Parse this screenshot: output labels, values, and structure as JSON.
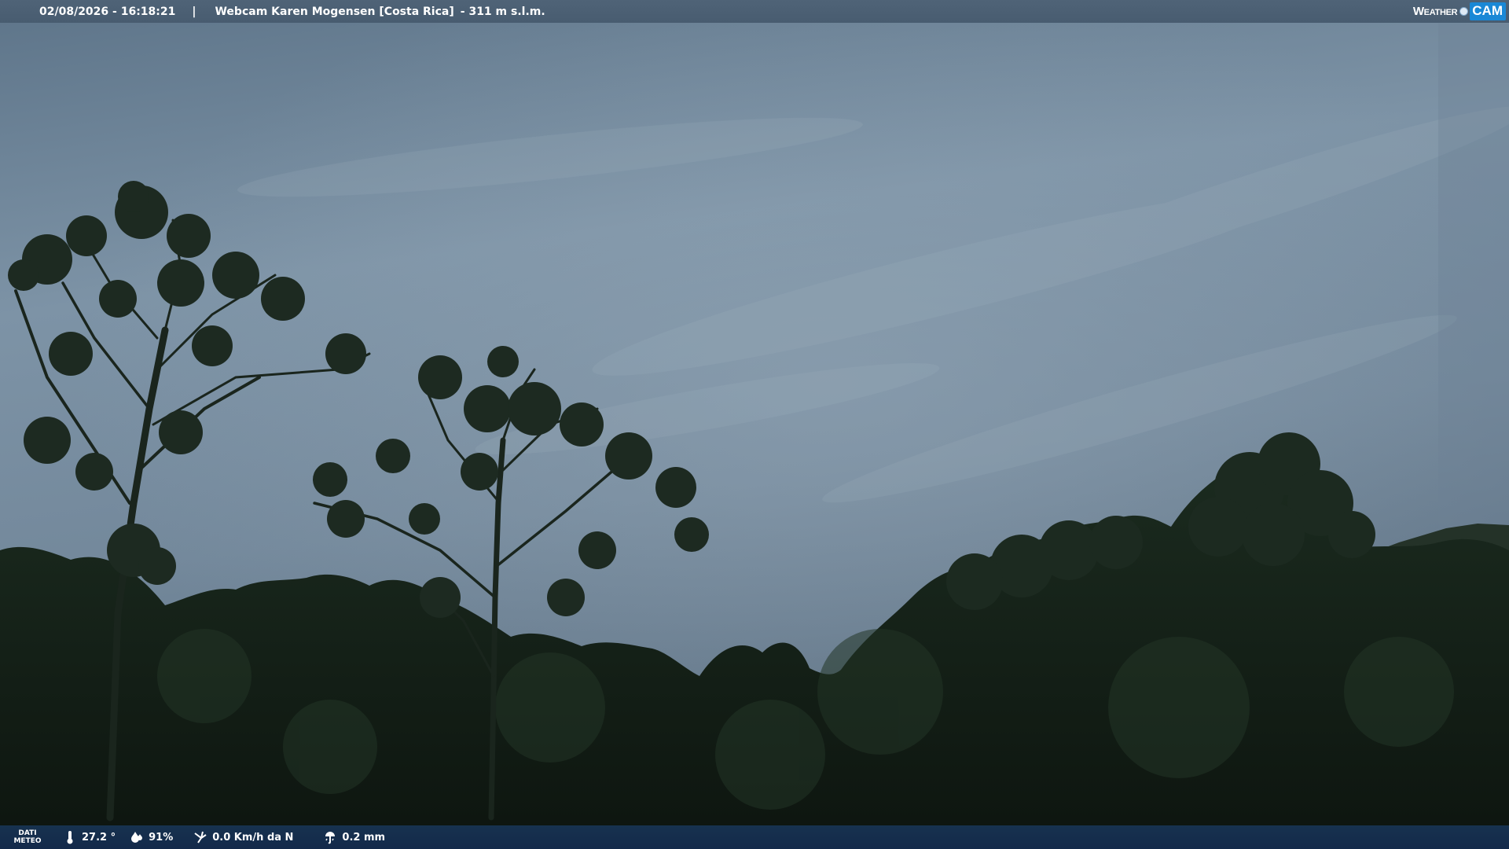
{
  "header": {
    "datetime": "02/08/2026 - 16:18:21",
    "separator": "|",
    "title": "Webcam Karen Mogensen [Costa Rica]",
    "elevation": "- 311 m s.l.m."
  },
  "logo": {
    "weather": "Weather",
    "cam": "CAM"
  },
  "footer": {
    "label_line1": "DATI",
    "label_line2": "METEO",
    "temperature": "27.2 °",
    "humidity": "91%",
    "wind": "0.0 Km/h da N",
    "rain": "0.2 mm"
  },
  "icons": {
    "temperature": "thermometer-icon",
    "humidity": "humidity-icon",
    "wind": "wind-icon",
    "rain": "rain-gauge-icon"
  },
  "colors": {
    "sky_top": "#5d7489",
    "sky_mid": "#7f94a6",
    "sky_low": "#6a7e90",
    "foliage": "#172419",
    "foliage_dark": "#0f1812",
    "bottom_bar": "#15304d",
    "logo_blue": "#1a88d6"
  }
}
